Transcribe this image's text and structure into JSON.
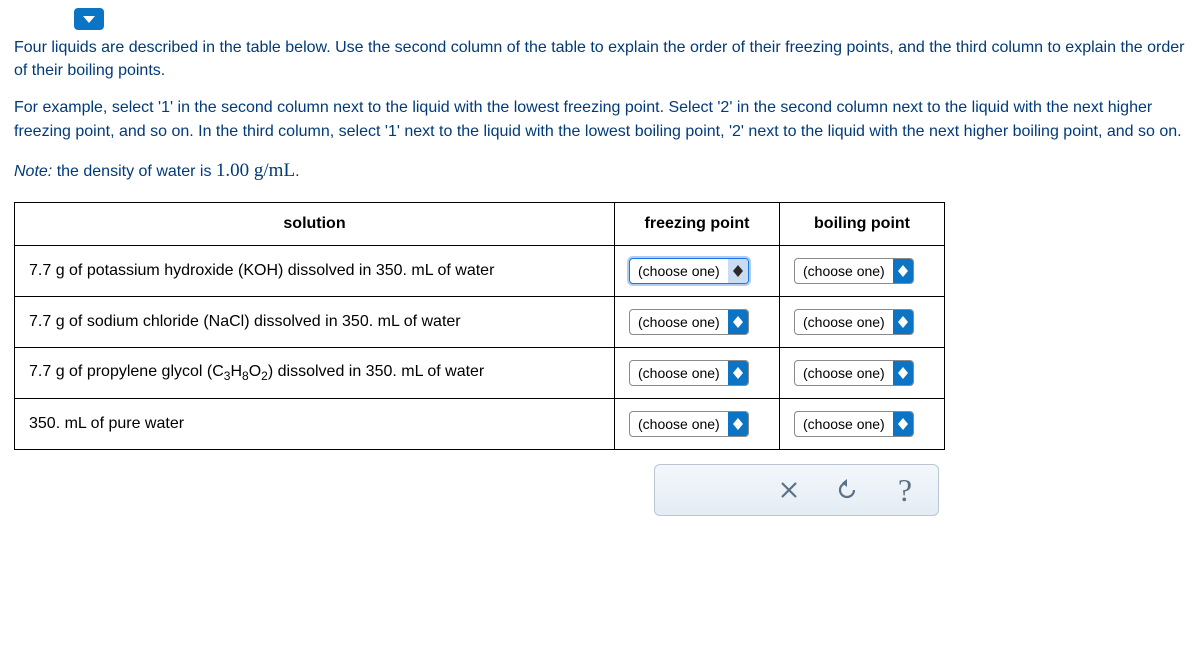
{
  "instructions": {
    "p1": "Four liquids are described in the table below. Use the second column of the table to explain the order of their freezing points, and the third column to explain the order of their boiling points.",
    "p2": "For example, select '1' in the second column next to the liquid with the lowest freezing point. Select '2' in the second column next to the liquid with the next higher freezing point, and so on. In the third column, select '1' next to the liquid with the lowest boiling point, '2' next to the liquid with the next higher boiling point, and so on.",
    "note_prefix": "Note:",
    "note_text": " the density of water is ",
    "density": "1.00 g/mL",
    "note_period": "."
  },
  "table": {
    "headers": {
      "solution": "solution",
      "freezing": "freezing point",
      "boiling": "boiling point"
    },
    "rows": [
      {
        "pre": "7.7 g of potassium hydroxide (KOH) dissolved in 350. mL of water",
        "formula": "",
        "post": "",
        "fp": "(choose one)",
        "bp": "(choose one)",
        "fp_focused": true
      },
      {
        "pre": "7.7 g of sodium chloride (NaCl) dissolved in 350. mL of water",
        "formula": "",
        "post": "",
        "fp": "(choose one)",
        "bp": "(choose one)"
      },
      {
        "pre": "7.7 g of propylene glycol (C",
        "formula": "3H8O2",
        "post": ") dissolved in 350. mL of water",
        "fp": "(choose one)",
        "bp": "(choose one)"
      },
      {
        "pre": "350. mL of pure water",
        "formula": "",
        "post": "",
        "fp": "(choose one)",
        "bp": "(choose one)"
      }
    ]
  },
  "toolbar": {
    "close": "×",
    "reset": "↺",
    "help": "?"
  }
}
